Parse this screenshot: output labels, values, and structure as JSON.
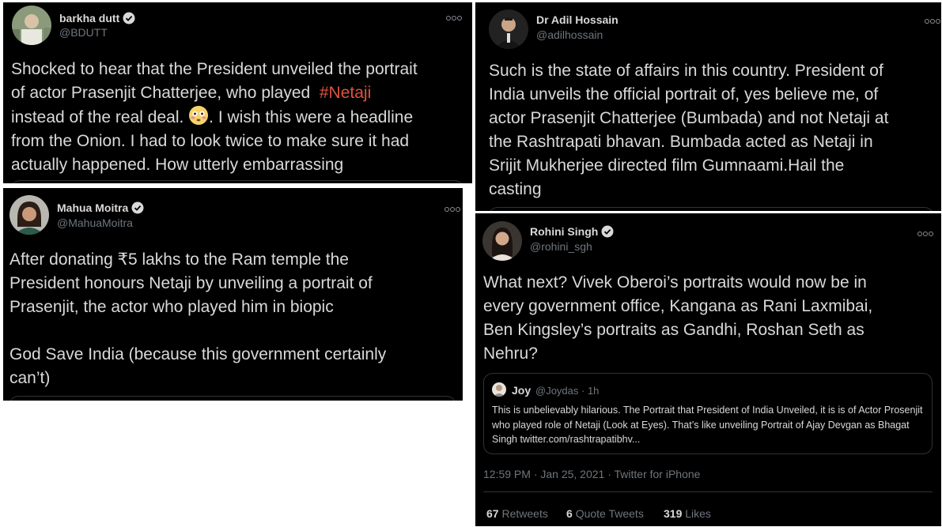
{
  "tweets": {
    "barkha": {
      "name": "barkha dutt",
      "handle": "@BDUTT",
      "text_before_hashtag": "Shocked to hear that the President unveiled the portrait\nof actor Prasenjit Chatterjee, who played  ",
      "hashtag": "#Netaji",
      "text_after_hashtag": "\ninstead of the real deal. ",
      "text_after_emoji": ". I wish this were a headline\nfrom the Onion. I had to look twice to make sure it had\nactually happened. How utterly embarrassing",
      "emoji": "flushed-face-emoji"
    },
    "adil": {
      "name": "Dr Adil Hossain",
      "handle": "@adilhossain",
      "text": "Such is the state of affairs in this country. President of\nIndia unveils the official portrait of, yes believe me, of\nactor Prasenjit Chatterjee (Bumbada) and not Netaji at\nthe Rashtrapati bhavan. Bumbada acted as Netaji in\nSrijit Mukherjee directed film Gumnaami.Hail the\ncasting"
    },
    "mahua": {
      "name": "Mahua Moitra",
      "handle": "@MahuaMoitra",
      "text": "After donating ₹5 lakhs to the Ram temple the\nPresident honours Netaji by unveiling a portrait of\nPrasenjit, the actor who played him in biopic\n\nGod Save India (because this government certainly\ncan’t)"
    },
    "rohini": {
      "name": "Rohini Singh",
      "handle": "@rohini_sgh",
      "text": "What next? Vivek Oberoi’s portraits would now be in\nevery government office, Kangana as Rani Laxmibai,\nBen Kingsley’s portraits as Gandhi, Roshan Seth as\nNehru?",
      "quote": {
        "name": "Joy",
        "handle": "@Joydas",
        "time": "· 1h",
        "text": "This is unbelievably hilarious. The Portrait that President of India Unveiled, it is is of Actor Prosenjit who played role of Netaji (Look at Eyes). That’s like unveiling Portrait of Ajay Devgan as Bhagat Singh twitter.com/rashtrapatibhv..."
      },
      "timestamp": "12:59 PM · Jan 25, 2021 · Twitter for iPhone",
      "stats": {
        "retweets": "67",
        "retweets_label": "Retweets",
        "quotes": "6",
        "quotes_label": "Quote Tweets",
        "likes": "319",
        "likes_label": "Likes"
      }
    }
  },
  "colors": {
    "card_bg": "#000000",
    "text": "#d9d9d9",
    "muted": "#6e767d",
    "hashtag": "#e0533d",
    "border": "#2f3336"
  },
  "icons": {
    "verified": "verified-badge-icon",
    "more": "more-options-icon"
  }
}
